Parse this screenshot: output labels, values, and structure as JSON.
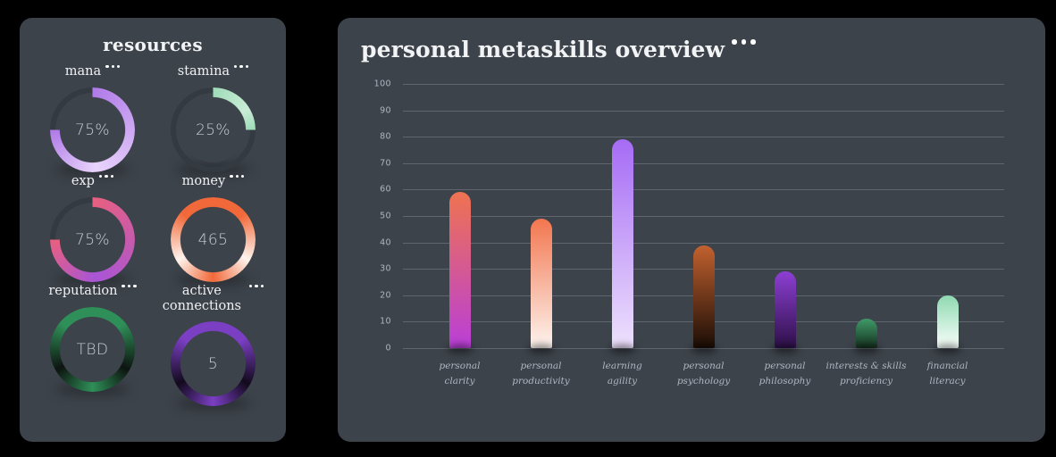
{
  "resources": {
    "title": "resources",
    "menu_icon": "ellipsis-icon",
    "metrics": [
      {
        "label": "mana",
        "value": "75%",
        "percent": 75,
        "kind": "arc",
        "gradient": [
          "#b07ae8",
          "#e8d4fb"
        ],
        "track": "#343a41"
      },
      {
        "label": "stamina",
        "value": "25%",
        "percent": 25,
        "kind": "arc",
        "gradient": [
          "#9fdcb8",
          "#c9ecd6"
        ],
        "track": "#343a41"
      },
      {
        "label": "exp",
        "value": "75%",
        "percent": 75,
        "kind": "arc",
        "gradient": [
          "#e8607f",
          "#a855d6"
        ],
        "track": "#343a41"
      },
      {
        "label": "money",
        "value": "465",
        "percent": 100,
        "kind": "full",
        "gradient": [
          "#f1693a",
          "#fdf3ec"
        ],
        "track": "#343a41"
      },
      {
        "label": "reputation",
        "value": "TBD",
        "percent": 100,
        "kind": "full",
        "gradient": [
          "#2f8f58",
          "#0d1410"
        ],
        "track": "#343a41"
      },
      {
        "label": "active connections",
        "value": "5",
        "percent": 100,
        "kind": "full",
        "gradient": [
          "#7b3fc4",
          "#120a1c"
        ],
        "track": "#343a41"
      }
    ]
  },
  "chart_panel": {
    "title": "personal metaskills overview",
    "menu_icon": "ellipsis-icon"
  },
  "chart_data": {
    "type": "bar",
    "title": "personal metaskills overview",
    "xlabel": "",
    "ylabel": "",
    "ylim": [
      0,
      100
    ],
    "yticks": [
      100,
      90,
      80,
      70,
      60,
      50,
      40,
      30,
      20,
      10,
      0
    ],
    "grid": true,
    "legend": "none",
    "categories": [
      "personal clarity",
      "personal productivity",
      "learning agility",
      "personal psychology",
      "personal philosophy",
      "interests & skills proficiency",
      "financial literacy"
    ],
    "category_lines": [
      [
        "personal",
        "clarity"
      ],
      [
        "personal",
        "productivity"
      ],
      [
        "learning",
        "agility"
      ],
      [
        "personal",
        "psychology"
      ],
      [
        "personal",
        "philosophy"
      ],
      [
        "interests & skills",
        "proficiency"
      ],
      [
        "financial",
        "literacy"
      ]
    ],
    "values": [
      59,
      49,
      79,
      39,
      29,
      11,
      20
    ],
    "bar_colors": [
      {
        "top": "#ef7350",
        "bottom": "#b93fd8"
      },
      {
        "top": "#f2764f",
        "bottom": "#fdf4ef"
      },
      {
        "top": "#a66bf5",
        "bottom": "#eee2fd"
      },
      {
        "top": "#c2612f",
        "bottom": "#1a0d06"
      },
      {
        "top": "#8d3fd4",
        "bottom": "#2d1047"
      },
      {
        "top": "#3f9a68",
        "bottom": "#15301f"
      },
      {
        "top": "#8fd9b1",
        "bottom": "#fafffc"
      }
    ]
  },
  "theme": {
    "page_bg": "#000000",
    "panel_bg": "#3d434b",
    "text": "#f2f3f5",
    "muted_text": "#aeb5bf",
    "value_text": "#c9ced6",
    "gridline": "#7c838e"
  }
}
